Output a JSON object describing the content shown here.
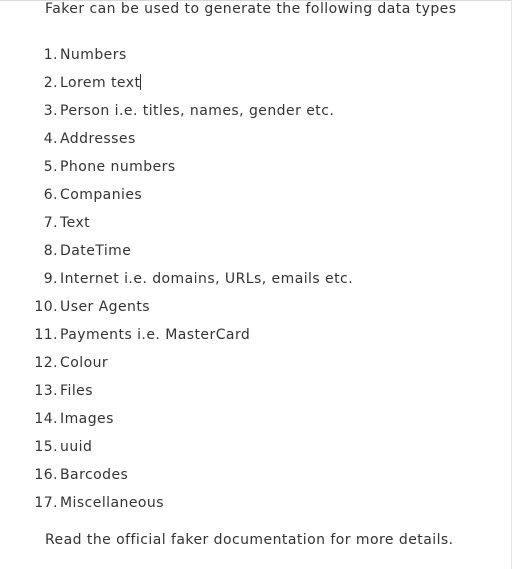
{
  "intro": "Faker can be used to generate the following data types",
  "items": [
    {
      "number": "1.",
      "label": "Numbers"
    },
    {
      "number": "2.",
      "label": "Lorem text"
    },
    {
      "number": "3.",
      "label": "Person i.e. titles, names, gender etc."
    },
    {
      "number": "4.",
      "label": "Addresses"
    },
    {
      "number": "5.",
      "label": "Phone numbers"
    },
    {
      "number": "6.",
      "label": "Companies"
    },
    {
      "number": "7.",
      "label": "Text"
    },
    {
      "number": "8.",
      "label": "DateTime"
    },
    {
      "number": "9.",
      "label": "Internet i.e. domains, URLs, emails etc."
    },
    {
      "number": "10.",
      "label": "User Agents"
    },
    {
      "number": "11.",
      "label": "Payments i.e. MasterCard"
    },
    {
      "number": "12.",
      "label": "Colour"
    },
    {
      "number": "13.",
      "label": "Files"
    },
    {
      "number": "14.",
      "label": "Images"
    },
    {
      "number": "15.",
      "label": "uuid"
    },
    {
      "number": "16.",
      "label": "Barcodes"
    },
    {
      "number": "17.",
      "label": "Miscellaneous"
    }
  ],
  "outro": "Read the official faker documentation for more details."
}
